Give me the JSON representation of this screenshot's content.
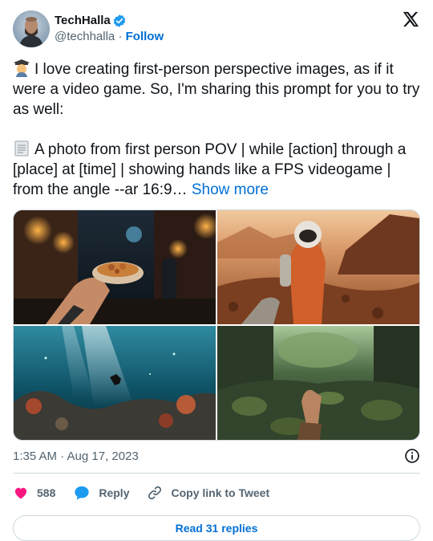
{
  "author": {
    "name": "TechHalla",
    "handle": "@techhalla",
    "separator": "·",
    "follow_label": "Follow"
  },
  "tweet": {
    "line1": "I love creating first-person perspective images, as if it were a video game. So, I'm sharing this prompt for you to try as well:",
    "line2": "A photo from first person POV | while [action] through a [place] at [time] | showing hands like a FPS videogame | from the angle --ar 16:9…",
    "show_more": "Show more"
  },
  "timestamp": "1:35 AM · Aug 17, 2023",
  "actions": {
    "likes": "588",
    "reply_label": "Reply",
    "copy_label": "Copy link to Tweet"
  },
  "replies_button": "Read 31 replies",
  "colors": {
    "accent": "#006fd6",
    "verified": "#1d9bf0",
    "like": "#f91880",
    "muted": "#536471"
  },
  "icons": [
    "verified-badge-icon",
    "x-logo-icon",
    "student-emoji-icon",
    "page-emoji-icon",
    "info-icon",
    "heart-icon",
    "reply-bubble-icon",
    "link-icon"
  ]
}
